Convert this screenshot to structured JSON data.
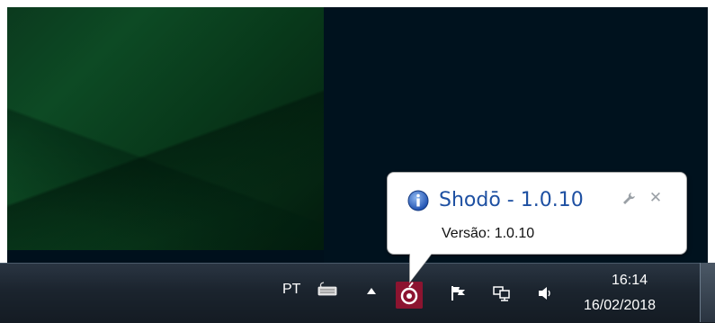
{
  "balloon": {
    "title": "Shodō - 1.0.10",
    "body": "Versão: 1.0.10",
    "icon": "info-icon",
    "close_glyph": "✕"
  },
  "tray": {
    "language": "PT",
    "icons": [
      "keyboard-icon",
      "show-hidden-icons-arrow",
      "shodo-app-icon",
      "action-center-flag-icon",
      "network-icon",
      "volume-icon"
    ]
  },
  "clock": {
    "time": "16:14",
    "date": "16/02/2018"
  },
  "colors": {
    "balloon_title": "#1e50a2",
    "taskbar": "#1b242e",
    "shodo_icon": "#8c1430"
  }
}
